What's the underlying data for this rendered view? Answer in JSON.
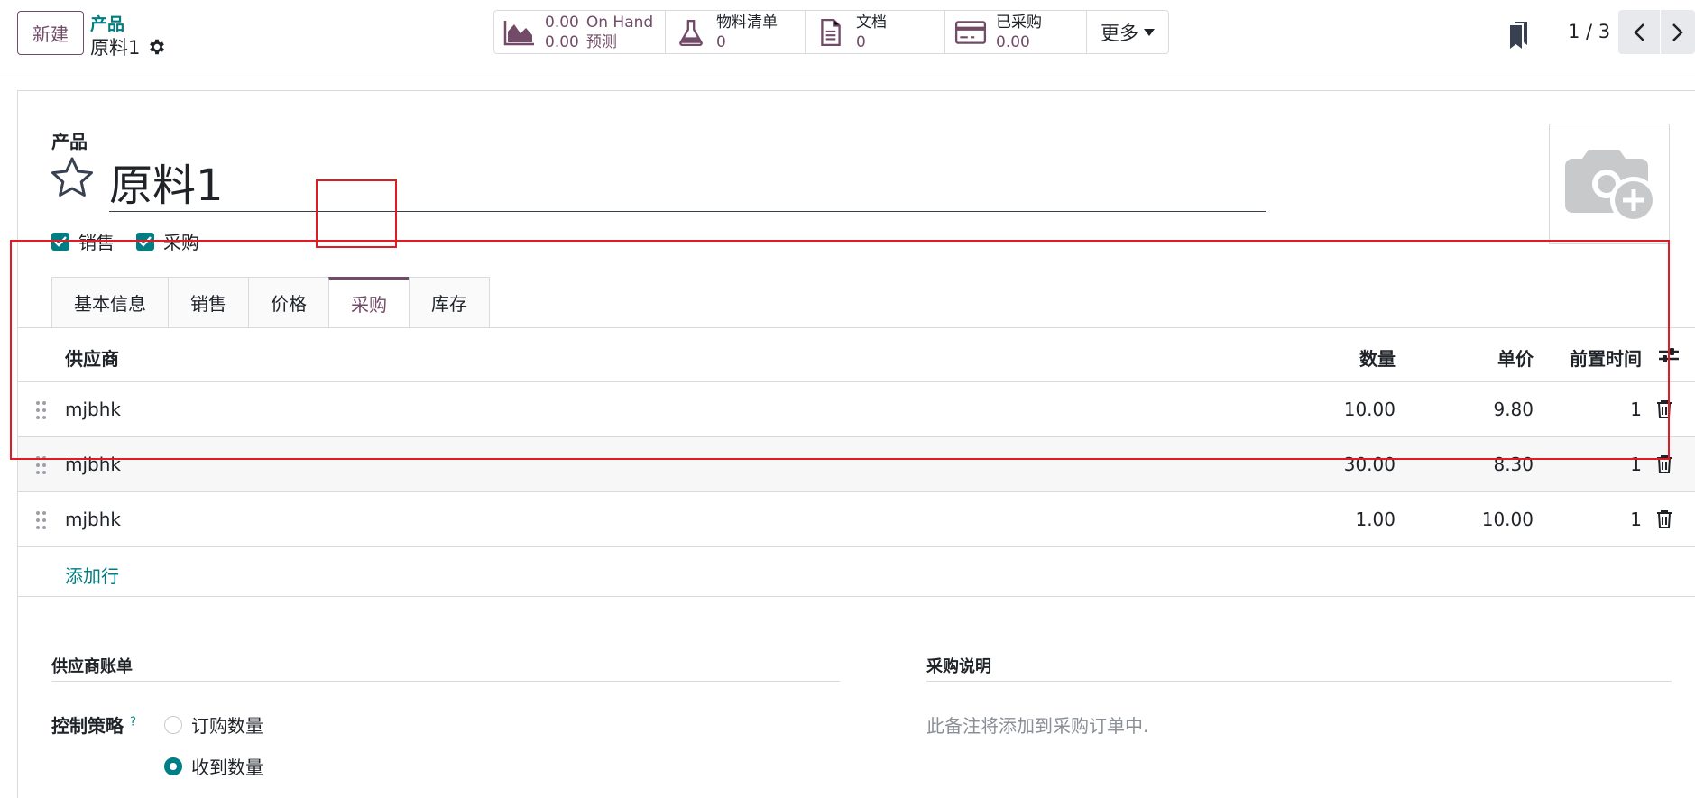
{
  "control_panel": {
    "new_label": "新建",
    "breadcrumb_parent": "产品",
    "breadcrumb_current": "原料1",
    "smart_buttons": {
      "on_hand_value": "0.00",
      "on_hand_label": "On Hand",
      "forecast_value": "0.00",
      "forecast_label": "预测",
      "bom_label": "物料清单",
      "bom_value": "0",
      "docs_label": "文档",
      "docs_value": "0",
      "purchased_label": "已采购",
      "purchased_value": "0.00",
      "more_label": "更多"
    },
    "pager": "1 / 3"
  },
  "form": {
    "product_label": "产品",
    "product_name": "原料1",
    "sale_ok_label": "销售",
    "purchase_ok_label": "采购",
    "tabs": [
      "基本信息",
      "销售",
      "价格",
      "采购",
      "库存"
    ],
    "active_tab": "采购"
  },
  "suppliers": {
    "headers": {
      "vendor": "供应商",
      "qty": "数量",
      "price": "单价",
      "delay": "前置时间"
    },
    "rows": [
      {
        "vendor": "mjbhk",
        "qty": "10.00",
        "price": "9.80",
        "delay": "1"
      },
      {
        "vendor": "mjbhk",
        "qty": "30.00",
        "price": "8.30",
        "delay": "1"
      },
      {
        "vendor": "mjbhk",
        "qty": "1.00",
        "price": "10.00",
        "delay": "1"
      }
    ],
    "add_line": "添加行"
  },
  "vendor_bills": {
    "title": "供应商账单",
    "control_label": "控制策略",
    "help": "?",
    "options": [
      "订购数量",
      "收到数量"
    ],
    "selected": "收到数量"
  },
  "purchase_description": {
    "title": "采购说明",
    "placeholder": "此备注将添加到采购订单中."
  },
  "colors": {
    "brand": "#714b67",
    "accent": "#017e84",
    "highlight": "#e01b24"
  }
}
